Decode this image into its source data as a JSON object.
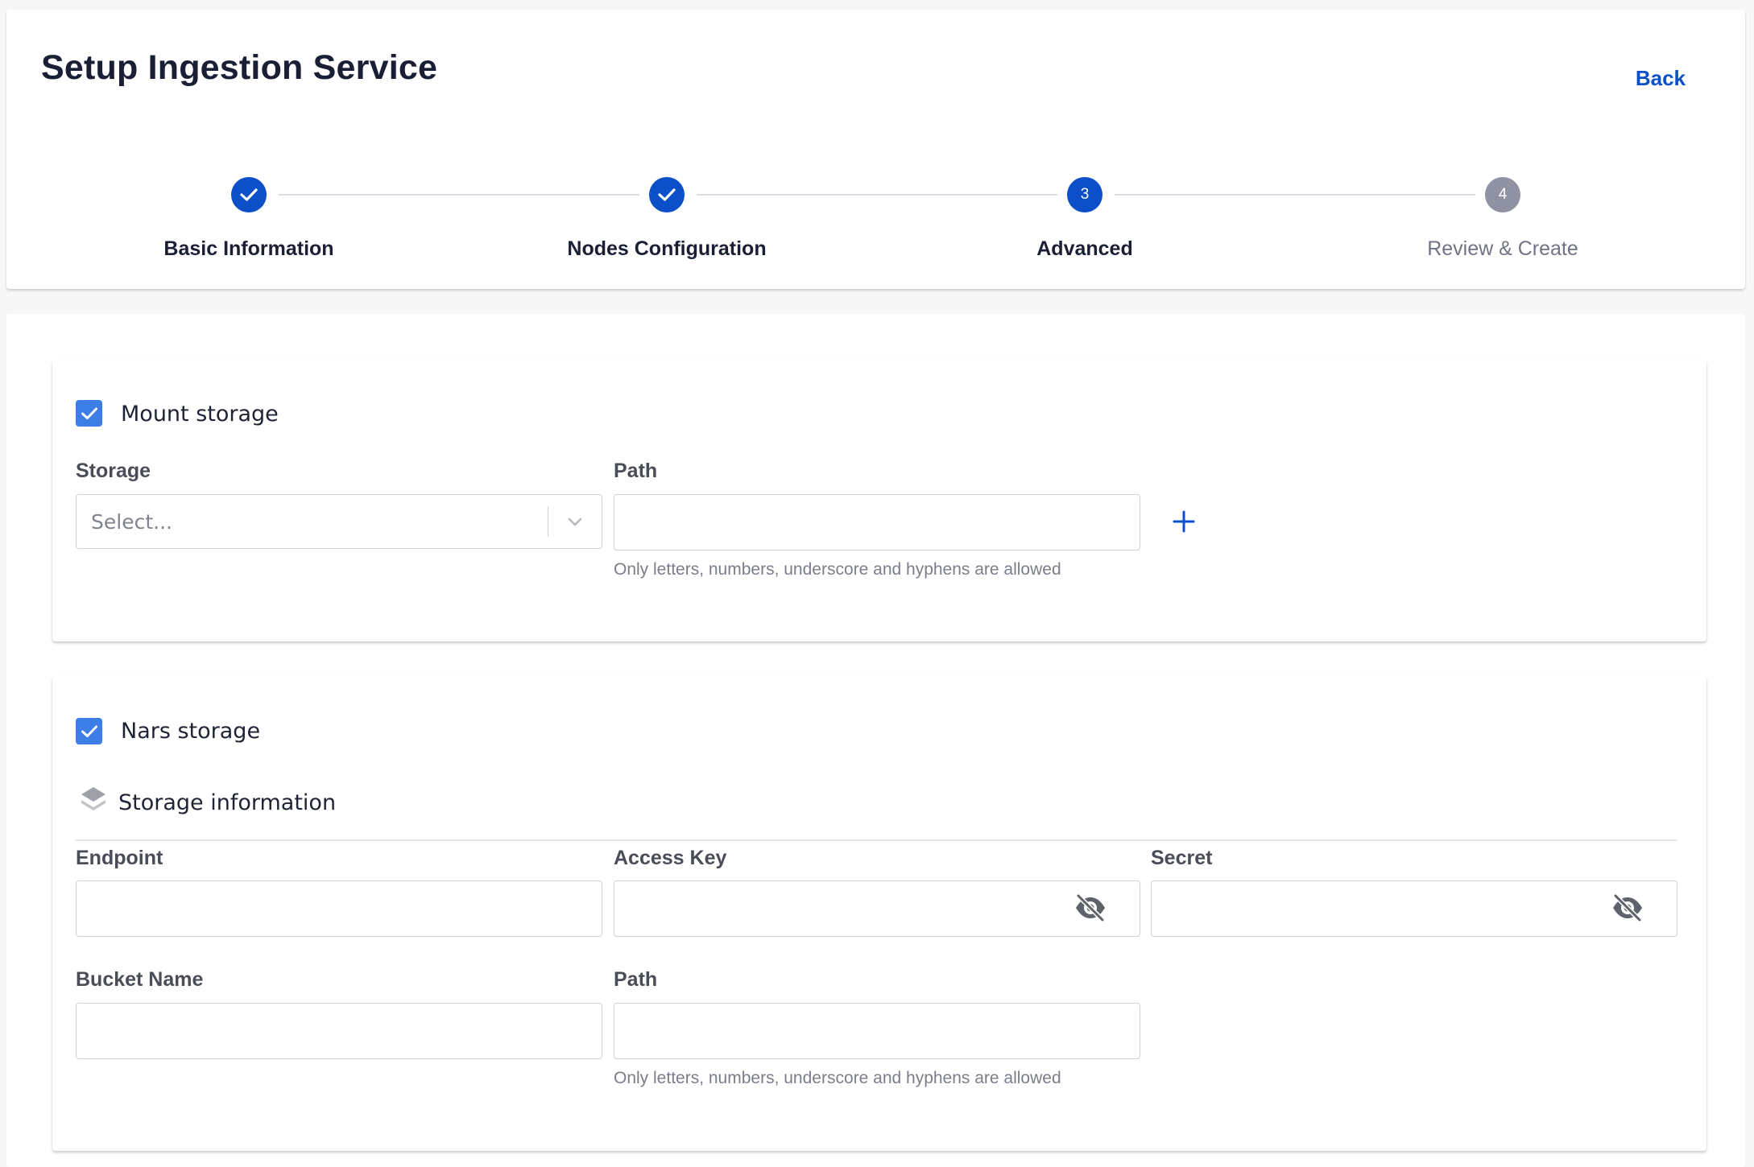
{
  "header": {
    "title": "Setup Ingestion Service",
    "back_label": "Back"
  },
  "stepper": {
    "steps": [
      {
        "number": "1",
        "label": "Basic Information",
        "state": "completed"
      },
      {
        "number": "2",
        "label": "Nodes Configuration",
        "state": "completed"
      },
      {
        "number": "3",
        "label": "Advanced",
        "state": "active"
      },
      {
        "number": "4",
        "label": "Review & Create",
        "state": "pending"
      }
    ]
  },
  "mount_storage": {
    "checkbox_label": "Mount storage",
    "checked": true,
    "storage_label": "Storage",
    "storage_placeholder": "Select...",
    "path_label": "Path",
    "path_value": "",
    "path_helper": "Only letters, numbers, underscore and hyphens are allowed"
  },
  "nars_storage": {
    "checkbox_label": "Nars storage",
    "checked": true,
    "info_title": "Storage information",
    "endpoint_label": "Endpoint",
    "endpoint_value": "",
    "access_key_label": "Access Key",
    "access_key_value": "",
    "secret_label": "Secret",
    "secret_value": "",
    "bucket_label": "Bucket Name",
    "bucket_value": "",
    "path_label": "Path",
    "path_value": "",
    "path_helper": "Only letters, numbers, underscore and hyphens are allowed"
  },
  "colors": {
    "primary": "#0b4fc9",
    "checkbox": "#3c7ee6",
    "pending_step": "#8e92a3"
  }
}
